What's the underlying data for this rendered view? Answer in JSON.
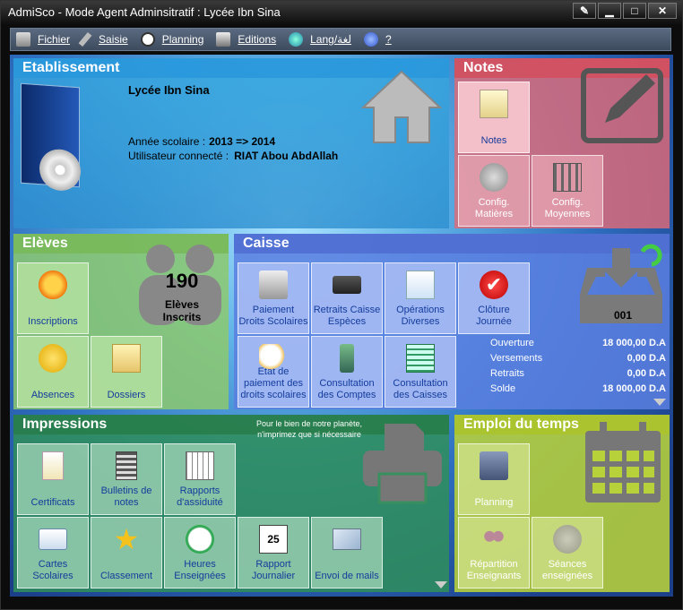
{
  "window": {
    "title": "AdmiSco - Mode Agent Adminsitratif : Lycée Ibn Sina"
  },
  "menu": {
    "items": [
      {
        "label": "Fichier",
        "icon": "book-icon"
      },
      {
        "label": "Saisie",
        "icon": "pen-icon"
      },
      {
        "label": "Planning",
        "icon": "clock-icon"
      },
      {
        "label": "Editions",
        "icon": "printer-icon"
      },
      {
        "label": "Lang/لغة",
        "icon": "globe-icon"
      },
      {
        "label": "?",
        "icon": "help-icon"
      }
    ]
  },
  "etablissement": {
    "title": "Etablissement",
    "school": "Lycée Ibn Sina",
    "year_label": "Année scolaire :",
    "year_value": "2013 => 2014",
    "user_label": "Utilisateur connecté :",
    "user_value": "RIAT Abou AbdAllah"
  },
  "notes": {
    "title": "Notes",
    "tiles": [
      "Notes",
      "Config. Matières",
      "Config. Moyennes"
    ]
  },
  "eleves": {
    "title": "Elèves",
    "count": "190",
    "count_label": "Elèves Inscrits",
    "tiles": [
      "Inscriptions",
      "Absences",
      "Dossiers"
    ]
  },
  "caisse": {
    "title": "Caisse",
    "tiles": [
      "Paiement Droits Scolaires",
      "Retraits Caisse Espèces",
      "Opérations Diverses",
      "Clôture Journée",
      "Etat de paiement des droits scolaires",
      "Consultation des Comptes",
      "Consultation des Caisses"
    ],
    "caisse_num": "001",
    "summary": [
      {
        "label": "Ouverture",
        "value": "18 000,00 D.A"
      },
      {
        "label": "Versements",
        "value": "0,00 D.A"
      },
      {
        "label": "Retraits",
        "value": "0,00 D.A"
      },
      {
        "label": "Solde",
        "value": "18 000,00 D.A"
      }
    ]
  },
  "impressions": {
    "title": "Impressions",
    "note": "Pour le bien de notre planète, n'imprimez que si nécessaire",
    "tiles": [
      "Certificats",
      "Bulletins de notes",
      "Rapports d'assiduité",
      "Cartes Scolaires",
      "Classement",
      "Heures Enseignées",
      "Rapport Journalier",
      "Envoi de mails"
    ]
  },
  "emploi": {
    "title": "Emploi du temps",
    "tiles": [
      "Planning",
      "Répartition Enseignants",
      "Séances enseignées"
    ]
  },
  "colors": {
    "notes": "#e06a78",
    "eleves": "#8cc96e",
    "caisse": "#5a7fe0",
    "impressions": "#2f8f5a",
    "emploi": "#b7d13a"
  }
}
